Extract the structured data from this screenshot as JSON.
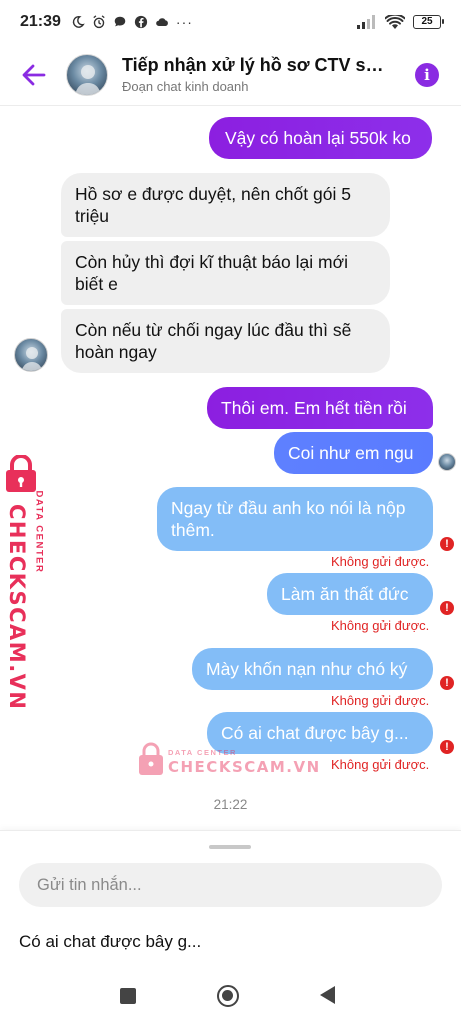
{
  "status_bar": {
    "time": "21:39",
    "battery": "25"
  },
  "header": {
    "title": "Tiếp nhận xử lý hồ sơ CTV sh...",
    "subtitle": "Đoạn chat kinh doanh"
  },
  "messages": [
    {
      "text": "Vậy có hoàn lại 550k ko"
    },
    {
      "text": "Hồ sơ e được duyệt, nên chốt gói 5 triệu"
    },
    {
      "text": "Còn hủy thì đợi kĩ thuật báo lại mới biết e"
    },
    {
      "text": "Còn nếu từ chối ngay lúc đầu thì sẽ hoàn ngay"
    },
    {
      "text": "Thôi em. Em hết tiền rồi"
    },
    {
      "text": "Coi như em ngu"
    },
    {
      "text": "Ngay từ đầu anh ko nói là nộp thêm."
    },
    {
      "text": "Làm ăn thất đức"
    },
    {
      "text": "Mày khốn nạn như chó ký"
    },
    {
      "text": "Có ai chat được bây g..."
    }
  ],
  "error_text": "Không gửi được.",
  "error_icon": "!",
  "time_separator": "21:22",
  "watermark": {
    "line1": "DATA CENTER",
    "line2": "CHECKSCAM.VN"
  },
  "composer": {
    "placeholder": "Gửi tin nhắn...",
    "draft": "Có ai chat được bây g..."
  },
  "colors": {
    "purple": "#8c1fe0",
    "blue": "#5e80ff",
    "light_blue": "#83bdf7",
    "error": "#e02424",
    "watermark": "#e8305a"
  },
  "icons": [
    "moon-icon",
    "alarm-icon",
    "chat-icon",
    "facebook-icon",
    "cloud-icon",
    "signal-icon",
    "wifi-icon",
    "battery-icon",
    "back-arrow-icon",
    "info-icon",
    "error-icon",
    "lock-icon"
  ]
}
